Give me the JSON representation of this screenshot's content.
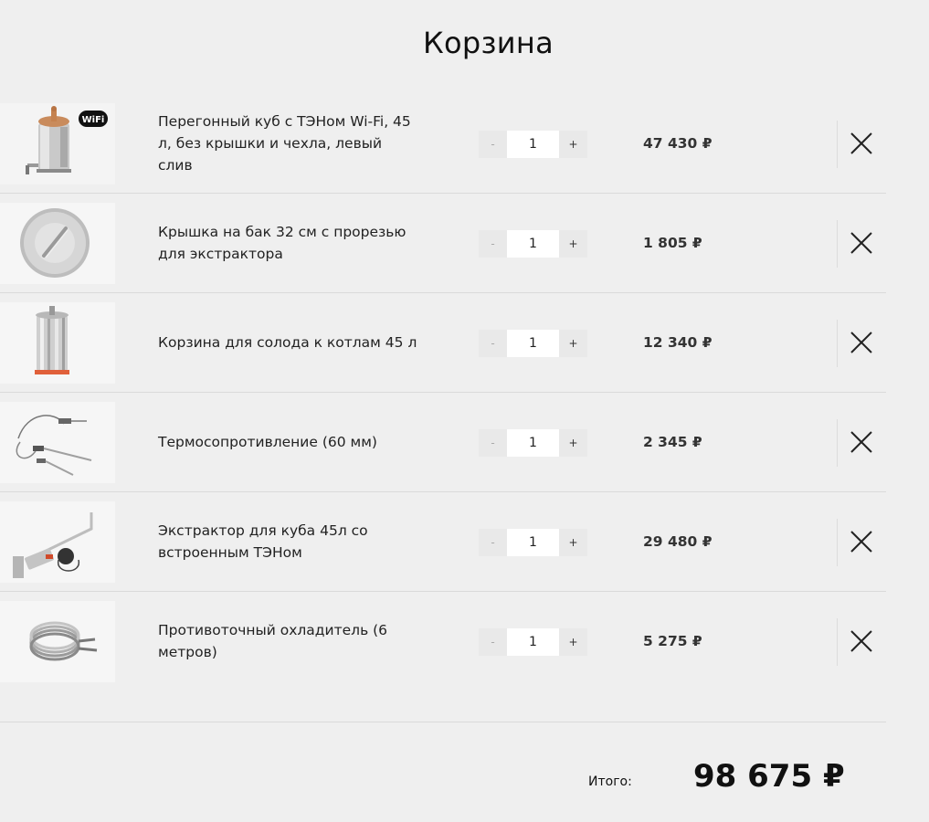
{
  "cart": {
    "title": "Корзина",
    "items": [
      {
        "name": "Перегонный куб с ТЭНом Wi-Fi, 45 л, без крышки и чехла, левый слив",
        "qty": "1",
        "price": "47 430 ₽",
        "minus_label": "-",
        "plus_label": "+",
        "image_icon": "still-pot-icon",
        "badge": "WiFi"
      },
      {
        "name": "Крышка на бак 32 см с прорезью для экстрактора",
        "qty": "1",
        "price": "1 805 ₽",
        "minus_label": "-",
        "plus_label": "+",
        "image_icon": "lid-icon"
      },
      {
        "name": "Корзина для солода к котлам 45 л",
        "qty": "1",
        "price": "12 340 ₽",
        "minus_label": "-",
        "plus_label": "+",
        "image_icon": "malt-basket-icon"
      },
      {
        "name": "Термосопротивление (60 мм)",
        "qty": "1",
        "price": "2 345 ₽",
        "minus_label": "-",
        "plus_label": "+",
        "image_icon": "thermo-sensor-icon"
      },
      {
        "name": "Экстрактор для куба 45л со встроенным ТЭНом",
        "qty": "1",
        "price": "29 480 ₽",
        "minus_label": "-",
        "plus_label": "+",
        "image_icon": "extractor-icon"
      },
      {
        "name": "Противоточный охладитель (6 метров)",
        "qty": "1",
        "price": "5 275 ₽",
        "minus_label": "-",
        "plus_label": "+",
        "image_icon": "coil-cooler-icon"
      }
    ],
    "total_label": "Итого:",
    "total_value": "98 675 ₽",
    "remove_icon": "close-icon"
  }
}
